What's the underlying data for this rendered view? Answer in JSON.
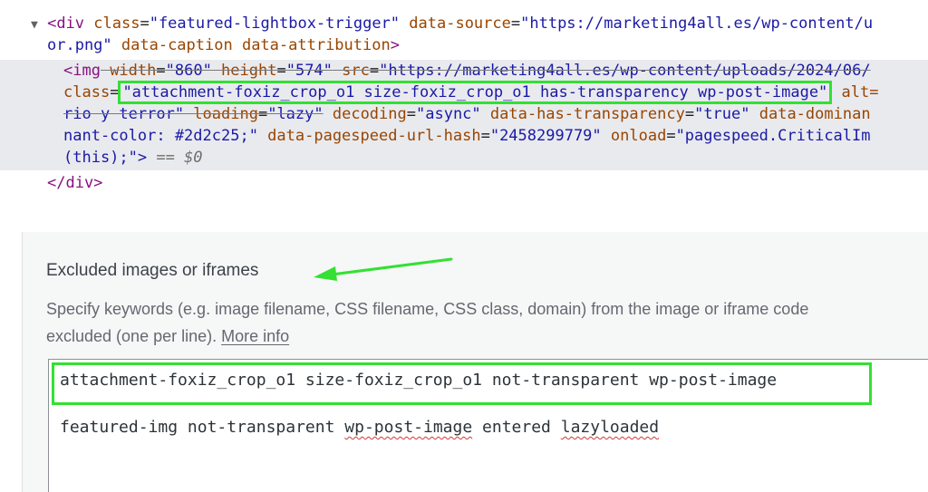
{
  "devtools": {
    "line1": {
      "triangle": "▼",
      "open": "<div",
      "class_attr": " class",
      "class_val": "\"featured-lightbox-trigger\"",
      "source_attr": " data-source",
      "source_val": "\"https://marketing4all.es/wp-content/u"
    },
    "line2": {
      "source_val_end": "or.png\"",
      "caption_attr": " data-caption",
      "attribution_attr": " data-attribution",
      "close": ">"
    },
    "line3": {
      "open": "<img",
      "width_attr": " width",
      "width_val": "\"860\"",
      "height_attr": " height",
      "height_val": "\"574\"",
      "src_attr": " src",
      "src_val": "\"https://marketing4all.es/wp-content/uploads/2024/06/"
    },
    "line4": {
      "class_attr": "class",
      "eq": "=",
      "class_val": "\"attachment-foxiz_crop_o1 size-foxiz_crop_o1 has-transparency wp-post-image\"",
      "alt_attr": " alt="
    },
    "line5": {
      "alt_val_end": "rio y terror\"",
      "loading_attr": " loading",
      "loading_val": "\"lazy\"",
      "decoding_attr": " decoding",
      "decoding_val": "\"async\"",
      "transp_attr": " data-has-transparency",
      "transp_val": "\"true\"",
      "dominant_attr": " data-dominan"
    },
    "line6": {
      "style_val_end": "nant-color: #2d2c25;\"",
      "hash_attr": " data-pagespeed-url-hash",
      "hash_val": "\"2458299779\"",
      "onload_attr": " onload",
      "onload_val": "\"pagespeed.CriticalIm"
    },
    "line7": {
      "onload_val_end": "(this);\">",
      "eq_ref": " == $0"
    },
    "line8": {
      "close": "</div>"
    }
  },
  "settings": {
    "title": "Excluded images or iframes",
    "desc_line1": "Specify keywords (e.g. image filename, CSS filename, CSS class, domain) from the image or iframe code",
    "desc_line2_prefix": "excluded (one per line). ",
    "more_info": "More info",
    "textarea_lines": [
      "attachment-foxiz_crop_o1 size-foxiz_crop_o1 not-transparent wp-post-image",
      "featured-img not-transparent wp-post-image entered lazyloaded"
    ]
  },
  "colors": {
    "highlight_box": "#33e033",
    "arrow": "#33e033",
    "tag": "#881280",
    "attribute": "#994500",
    "value": "#1a1aa6"
  }
}
